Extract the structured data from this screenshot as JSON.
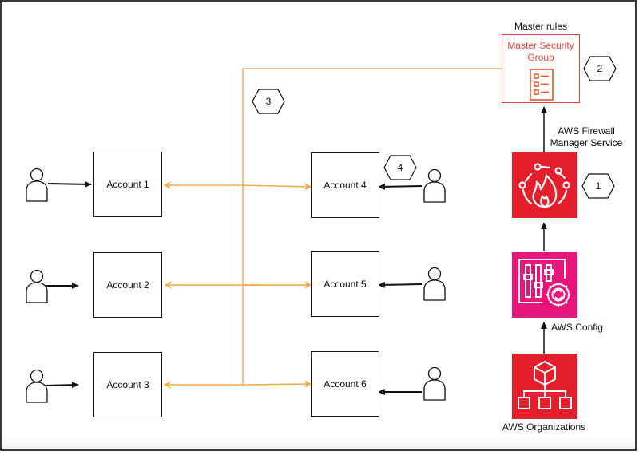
{
  "diagram": {
    "master_rules_label": "Master rules",
    "master_security_group": {
      "title": "Master Security Group",
      "icon": "checklist-icon",
      "color": "#e8403b"
    },
    "services": [
      {
        "id": "firewall-manager",
        "label": "AWS Firewall Manager Service",
        "icon": "firewall-manager-icon",
        "color": "#e41f2b",
        "step": "1"
      },
      {
        "id": "config",
        "label": "AWS Config",
        "icon": "config-icon",
        "color": "#e7157b"
      },
      {
        "id": "organizations",
        "label": "AWS Organizations",
        "icon": "organizations-icon",
        "color": "#e41f2b"
      }
    ],
    "steps": {
      "master_sg": "2",
      "distribution": "3",
      "account_users": "4"
    },
    "accounts": [
      {
        "label": "Account 1"
      },
      {
        "label": "Account 2"
      },
      {
        "label": "Account 3"
      },
      {
        "label": "Account 4"
      },
      {
        "label": "Account 5"
      },
      {
        "label": "Account 6"
      }
    ],
    "colors": {
      "flow_line": "#f7a94b",
      "border": "#1a1a1a"
    }
  }
}
